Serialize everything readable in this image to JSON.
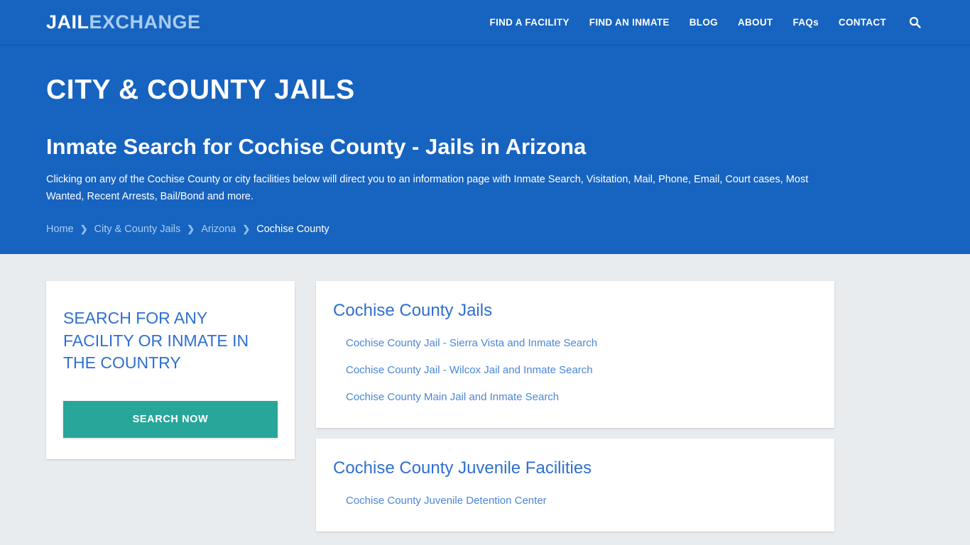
{
  "header": {
    "logo": {
      "part1": "JAIL",
      "part2": "EXCHANGE"
    },
    "nav": [
      {
        "label": "FIND A FACILITY",
        "name": "nav-find-a-facility"
      },
      {
        "label": "FIND AN INMATE",
        "name": "nav-find-an-inmate"
      },
      {
        "label": "BLOG",
        "name": "nav-blog"
      },
      {
        "label": "ABOUT",
        "name": "nav-about"
      },
      {
        "label": "FAQs",
        "name": "nav-faqs"
      },
      {
        "label": "CONTACT",
        "name": "nav-contact"
      }
    ],
    "search_icon": "search-icon"
  },
  "hero": {
    "eyebrow": "CITY & COUNTY JAILS",
    "title": "Inmate Search for Cochise County - Jails in Arizona",
    "description": "Clicking on any of the Cochise County or city facilities below will direct you to an information page with Inmate Search, Visitation, Mail, Phone, Email, Court cases, Most Wanted, Recent Arrests, Bail/Bond and more.",
    "breadcrumb": [
      {
        "label": "Home",
        "active": false
      },
      {
        "label": "City & County Jails",
        "active": false
      },
      {
        "label": "Arizona",
        "active": false
      },
      {
        "label": "Cochise County",
        "active": true
      }
    ],
    "breadcrumb_separator": "❯"
  },
  "sidebar": {
    "search_card": {
      "title": "SEARCH FOR ANY FACILITY OR INMATE IN THE COUNTRY",
      "button_label": "SEARCH NOW"
    }
  },
  "main": {
    "sections": [
      {
        "title": "Cochise County Jails",
        "links": [
          "Cochise County Jail - Sierra Vista and Inmate Search",
          "Cochise County Jail - Wilcox Jail and Inmate Search",
          "Cochise County Main Jail and Inmate Search"
        ]
      },
      {
        "title": "Cochise County Juvenile Facilities",
        "links": [
          "Cochise County Juvenile Detention Center"
        ]
      }
    ]
  },
  "colors": {
    "brand_blue": "#1763c0",
    "logo_light": "#a8cdf0",
    "heading_blue": "#2f6fd0",
    "link_blue": "#4a86d8",
    "teal_button": "#27a699",
    "page_background": "#e9ecef"
  }
}
